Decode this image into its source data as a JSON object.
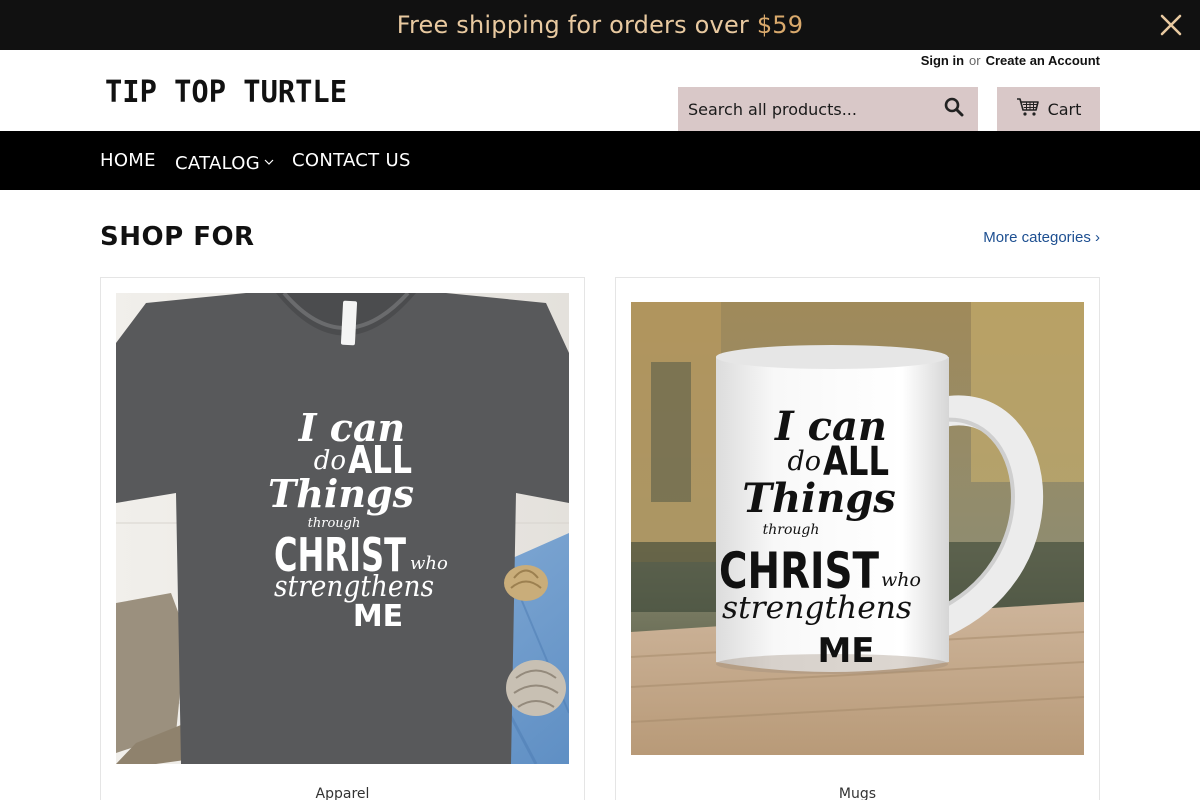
{
  "announcement": {
    "text_prefix": "Free shipping for orders over ",
    "amount": "$59"
  },
  "account": {
    "sign_in": "Sign in",
    "or": "or",
    "create_account": "Create an Account"
  },
  "logo_text": "TIP TOP TURTLE",
  "search": {
    "placeholder": "Search all products..."
  },
  "cart": {
    "label": "Cart"
  },
  "nav": {
    "items": [
      "HOME",
      "CATALOG",
      "CONTACT US"
    ]
  },
  "shop_for": {
    "title": "SHOP FOR",
    "more_link": "More categories ›"
  },
  "collections": [
    {
      "caption": "Apparel",
      "print": [
        "I can",
        "do",
        "ALL",
        "Things",
        "through",
        "CHRIST",
        "who",
        "strengthens",
        "ME"
      ]
    },
    {
      "caption": "Mugs",
      "print": [
        "I can",
        "do",
        "ALL",
        "Things",
        "through",
        "CHRIST",
        "who",
        "strengthens",
        "ME"
      ]
    }
  ],
  "colors": {
    "announce_bg": "#111111",
    "announce_text": "#e8c9a0",
    "nav_bg": "#000000",
    "button_bg": "#d9c8c8",
    "link": "#1d4f91"
  }
}
